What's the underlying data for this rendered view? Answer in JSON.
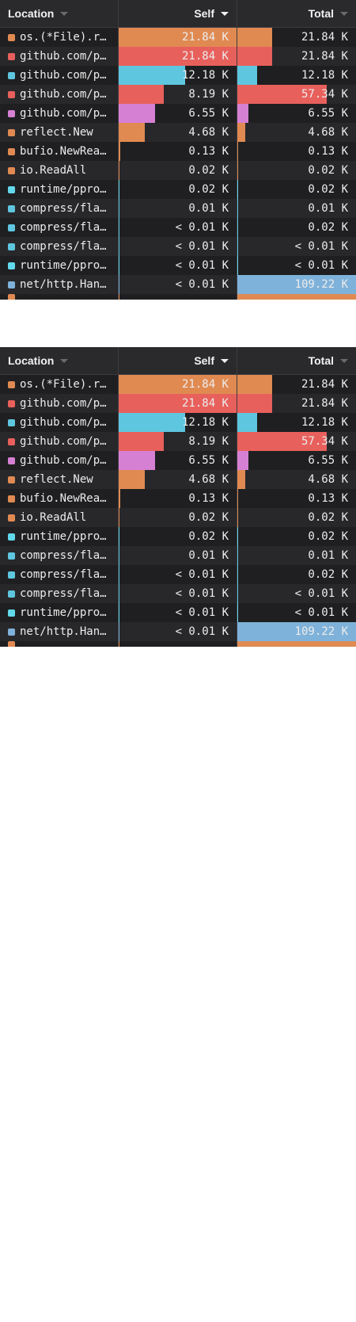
{
  "columns": {
    "location": "Location",
    "self": "Self",
    "total": "Total"
  },
  "sort": {
    "column": "self",
    "direction": "descending"
  },
  "colors": {
    "orange": "#e08a52",
    "red": "#e8605c",
    "cyan": "#5ec6df",
    "pink": "#d680d4",
    "lightcyan": "#62d8ec",
    "blue": "#7fb2da",
    "background": "#1f1f21",
    "header": "#2a2a2d"
  },
  "panels": [
    {
      "rows": [
        {
          "location": "os.(*File).r…",
          "color": "orange",
          "self": "21.84 K",
          "self_fraction": 1.0,
          "total": "21.84 K",
          "total_fraction": 0.285
        },
        {
          "location": "github.com/p…",
          "color": "red",
          "self": "21.84 K",
          "self_fraction": 1.0,
          "total": "21.84 K",
          "total_fraction": 0.285
        },
        {
          "location": "github.com/p…",
          "color": "cyan",
          "self": "12.18 K",
          "self_fraction": 0.557,
          "total": "12.18 K",
          "total_fraction": 0.159
        },
        {
          "location": "github.com/p…",
          "color": "red",
          "self": "8.19 K",
          "self_fraction": 0.375,
          "total": "57.34 K",
          "total_fraction": 0.748
        },
        {
          "location": "github.com/p…",
          "color": "pink",
          "self": "6.55 K",
          "self_fraction": 0.3,
          "total": "6.55 K",
          "total_fraction": 0.085
        },
        {
          "location": "reflect.New",
          "color": "orange",
          "self": "4.68 K",
          "self_fraction": 0.214,
          "total": "4.68 K",
          "total_fraction": 0.061
        },
        {
          "location": "bufio.NewRea…",
          "color": "orange",
          "self": "0.13 K",
          "self_fraction": 0.006,
          "total": "0.13 K",
          "total_fraction": 0.002
        },
        {
          "location": "io.ReadAll",
          "color": "orange",
          "self": "0.02 K",
          "self_fraction": 0.001,
          "total": "0.02 K",
          "total_fraction": 0.0003
        },
        {
          "location": "runtime/ppro…",
          "color": "lightcyan",
          "self": "0.02 K",
          "self_fraction": 0.001,
          "total": "0.02 K",
          "total_fraction": 0.0003
        },
        {
          "location": "compress/fla…",
          "color": "cyan",
          "self": "0.01 K",
          "self_fraction": 0.0005,
          "total": "0.01 K",
          "total_fraction": 0.0001
        },
        {
          "location": "compress/fla…",
          "color": "cyan",
          "self": "< 0.01 K",
          "self_fraction": 0.0002,
          "total": "0.02 K",
          "total_fraction": 0.0003
        },
        {
          "location": "compress/fla…",
          "color": "cyan",
          "self": "< 0.01 K",
          "self_fraction": 0.0002,
          "total": "< 0.01 K",
          "total_fraction": 0.0001
        },
        {
          "location": "runtime/ppro…",
          "color": "lightcyan",
          "self": "< 0.01 K",
          "self_fraction": 0.0002,
          "total": "< 0.01 K",
          "total_fraction": 0.0001
        },
        {
          "location": "net/http.Han…",
          "color": "blue",
          "self": "< 0.01 K",
          "self_fraction": 0.0002,
          "total": "109.22 K",
          "total_fraction": 1.0
        },
        {
          "location": "",
          "color": "orange",
          "self": "",
          "self_fraction": 0.0,
          "total": "",
          "total_fraction": 1.0,
          "clipped": true
        }
      ]
    },
    {
      "rows": [
        {
          "location": "os.(*File).r…",
          "color": "orange",
          "self": "21.84 K",
          "self_fraction": 1.0,
          "total": "21.84 K",
          "total_fraction": 0.285
        },
        {
          "location": "github.com/p…",
          "color": "red",
          "self": "21.84 K",
          "self_fraction": 1.0,
          "total": "21.84 K",
          "total_fraction": 0.285
        },
        {
          "location": "github.com/p…",
          "color": "cyan",
          "self": "12.18 K",
          "self_fraction": 0.557,
          "total": "12.18 K",
          "total_fraction": 0.159
        },
        {
          "location": "github.com/p…",
          "color": "red",
          "self": "8.19 K",
          "self_fraction": 0.375,
          "total": "57.34 K",
          "total_fraction": 0.748
        },
        {
          "location": "github.com/p…",
          "color": "pink",
          "self": "6.55 K",
          "self_fraction": 0.3,
          "total": "6.55 K",
          "total_fraction": 0.085
        },
        {
          "location": "reflect.New",
          "color": "orange",
          "self": "4.68 K",
          "self_fraction": 0.214,
          "total": "4.68 K",
          "total_fraction": 0.061
        },
        {
          "location": "bufio.NewRea…",
          "color": "orange",
          "self": "0.13 K",
          "self_fraction": 0.006,
          "total": "0.13 K",
          "total_fraction": 0.002
        },
        {
          "location": "io.ReadAll",
          "color": "orange",
          "self": "0.02 K",
          "self_fraction": 0.001,
          "total": "0.02 K",
          "total_fraction": 0.0003
        },
        {
          "location": "runtime/ppro…",
          "color": "lightcyan",
          "self": "0.02 K",
          "self_fraction": 0.001,
          "total": "0.02 K",
          "total_fraction": 0.0003
        },
        {
          "location": "compress/fla…",
          "color": "cyan",
          "self": "0.01 K",
          "self_fraction": 0.0005,
          "total": "0.01 K",
          "total_fraction": 0.0001
        },
        {
          "location": "compress/fla…",
          "color": "cyan",
          "self": "< 0.01 K",
          "self_fraction": 0.0002,
          "total": "0.02 K",
          "total_fraction": 0.0003
        },
        {
          "location": "compress/fla…",
          "color": "cyan",
          "self": "< 0.01 K",
          "self_fraction": 0.0002,
          "total": "< 0.01 K",
          "total_fraction": 0.0001
        },
        {
          "location": "runtime/ppro…",
          "color": "lightcyan",
          "self": "< 0.01 K",
          "self_fraction": 0.0002,
          "total": "< 0.01 K",
          "total_fraction": 0.0001
        },
        {
          "location": "net/http.Han…",
          "color": "blue",
          "self": "< 0.01 K",
          "self_fraction": 0.0002,
          "total": "109.22 K",
          "total_fraction": 1.0
        },
        {
          "location": "",
          "color": "orange",
          "self": "",
          "self_fraction": 0.0,
          "total": "",
          "total_fraction": 1.0,
          "clipped": true
        }
      ]
    }
  ]
}
